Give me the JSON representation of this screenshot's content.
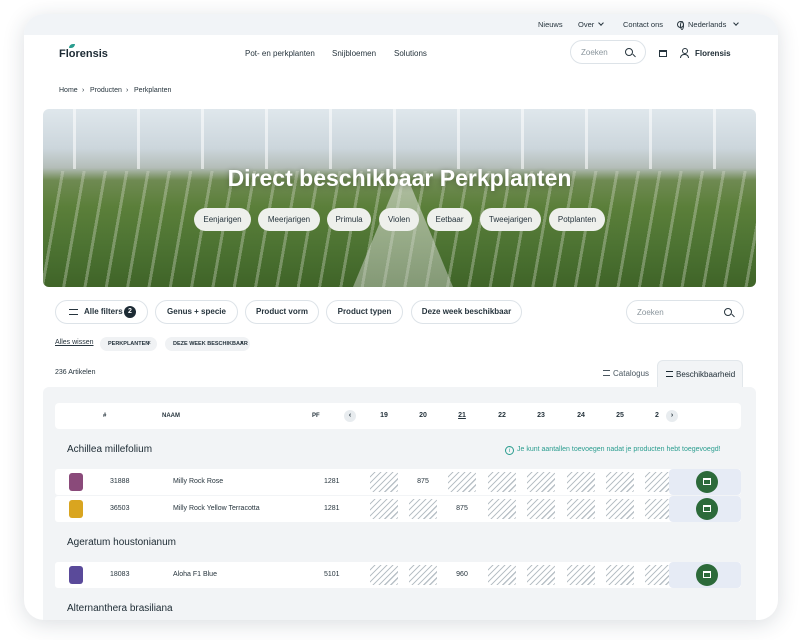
{
  "topbar": {
    "links": [
      "Nieuws",
      "Over",
      "Contact ons"
    ],
    "language": "Nederlands"
  },
  "header": {
    "logo": "Florensis",
    "nav": [
      "Pot- en perkplanten",
      "Snijbloemen",
      "Solutions"
    ],
    "search_placeholder": "Zoeken",
    "user": "Florensis"
  },
  "breadcrumb": [
    "Home",
    "Producten",
    "Perkplanten"
  ],
  "hero": {
    "title": "Direct beschikbaar Perkplanten",
    "chips": [
      "Eenjarigen",
      "Meerjarigen",
      "Primula",
      "Violen",
      "Eetbaar",
      "Tweejarigen",
      "Potplanten"
    ]
  },
  "filters": {
    "all_filters": "Alle filters",
    "all_filters_count": "2",
    "buttons": [
      "Genus + specie",
      "Product vorm",
      "Product typen",
      "Deze week beschikbaar"
    ],
    "search_placeholder": "Zoeken",
    "clear_all": "Alles wissen",
    "active_tags": [
      "PERKPLANTEN",
      "DEZE WEEK BESCHIKBAAR"
    ]
  },
  "results": {
    "count": "236 Artikelen",
    "tabs": [
      "Catalogus",
      "Beschikbaarheid"
    ],
    "active_tab": "Beschikbaarheid"
  },
  "table": {
    "headers": {
      "number": "#",
      "name": "NAAM",
      "pf": "PF"
    },
    "days": [
      "19",
      "20",
      "21",
      "22",
      "23",
      "24",
      "25",
      "2"
    ],
    "current_day": "21",
    "notice": "Je kunt aantallen toevoegen nadat je producten hebt toegevoegd!",
    "groups": [
      {
        "name": "Achillea millefolium",
        "rows": [
          {
            "number": "31888",
            "name": "Milly Rock Rose",
            "pf": "1281",
            "values": [
              "",
              "875",
              "",
              "",
              "",
              "",
              "",
              ""
            ],
            "thumb_color": "#8a4a7a"
          },
          {
            "number": "36503",
            "name": "Milly Rock Yellow Terracotta",
            "pf": "1281",
            "values": [
              "",
              "",
              "875",
              "",
              "",
              "",
              "",
              ""
            ],
            "thumb_color": "#d9a520"
          }
        ]
      },
      {
        "name": "Ageratum houstonianum",
        "rows": [
          {
            "number": "18083",
            "name": "Aloha F1 Blue",
            "pf": "5101",
            "values": [
              "",
              "",
              "960",
              "",
              "",
              "",
              "",
              ""
            ],
            "thumb_color": "#5a4a9a"
          }
        ]
      },
      {
        "name": "Alternanthera brasiliana",
        "rows": []
      }
    ]
  },
  "colors": {
    "accent_green": "#2c6a3a",
    "info_teal": "#2a9d8f",
    "text": "#1c2a33"
  }
}
